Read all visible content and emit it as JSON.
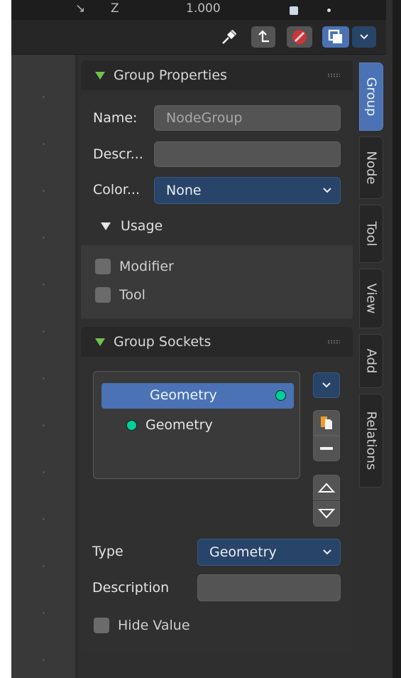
{
  "top_strip": {
    "axis_label": "Z",
    "value": "1.000"
  },
  "header": {
    "pin_icon": "pin-icon",
    "parent_icon": "parent-arrow-icon",
    "overlay_icon": "node-wrangler-icon",
    "view_toggle_icon": "overlay-toggle-icon",
    "chevron_icon": "chevron-down-icon"
  },
  "group_properties": {
    "title": "Group Properties",
    "name_label": "Name:",
    "name_value": "NodeGroup",
    "description_label": "Descr...",
    "description_value": "",
    "color_label": "Color...",
    "color_value": "None",
    "usage": {
      "title": "Usage",
      "options": [
        {
          "label": "Modifier",
          "checked": false
        },
        {
          "label": "Tool",
          "checked": false
        }
      ]
    }
  },
  "group_sockets": {
    "title": "Group Sockets",
    "items": [
      {
        "label": "Geometry",
        "direction": "output",
        "selected": true
      },
      {
        "label": "Geometry",
        "direction": "input",
        "selected": false
      }
    ],
    "type_label": "Type",
    "type_value": "Geometry",
    "description_label": "Description",
    "description_value": "",
    "hide_value_label": "Hide Value",
    "hide_value_checked": false
  },
  "tabs": [
    "Group",
    "Node",
    "Tool",
    "View",
    "Add",
    "Relations"
  ],
  "active_tab": "Group",
  "colors": {
    "accent": "#4a72b4",
    "dropdown": "#284468",
    "socket_geometry": "#00d19a",
    "panel_triangle": "#70c34a"
  }
}
